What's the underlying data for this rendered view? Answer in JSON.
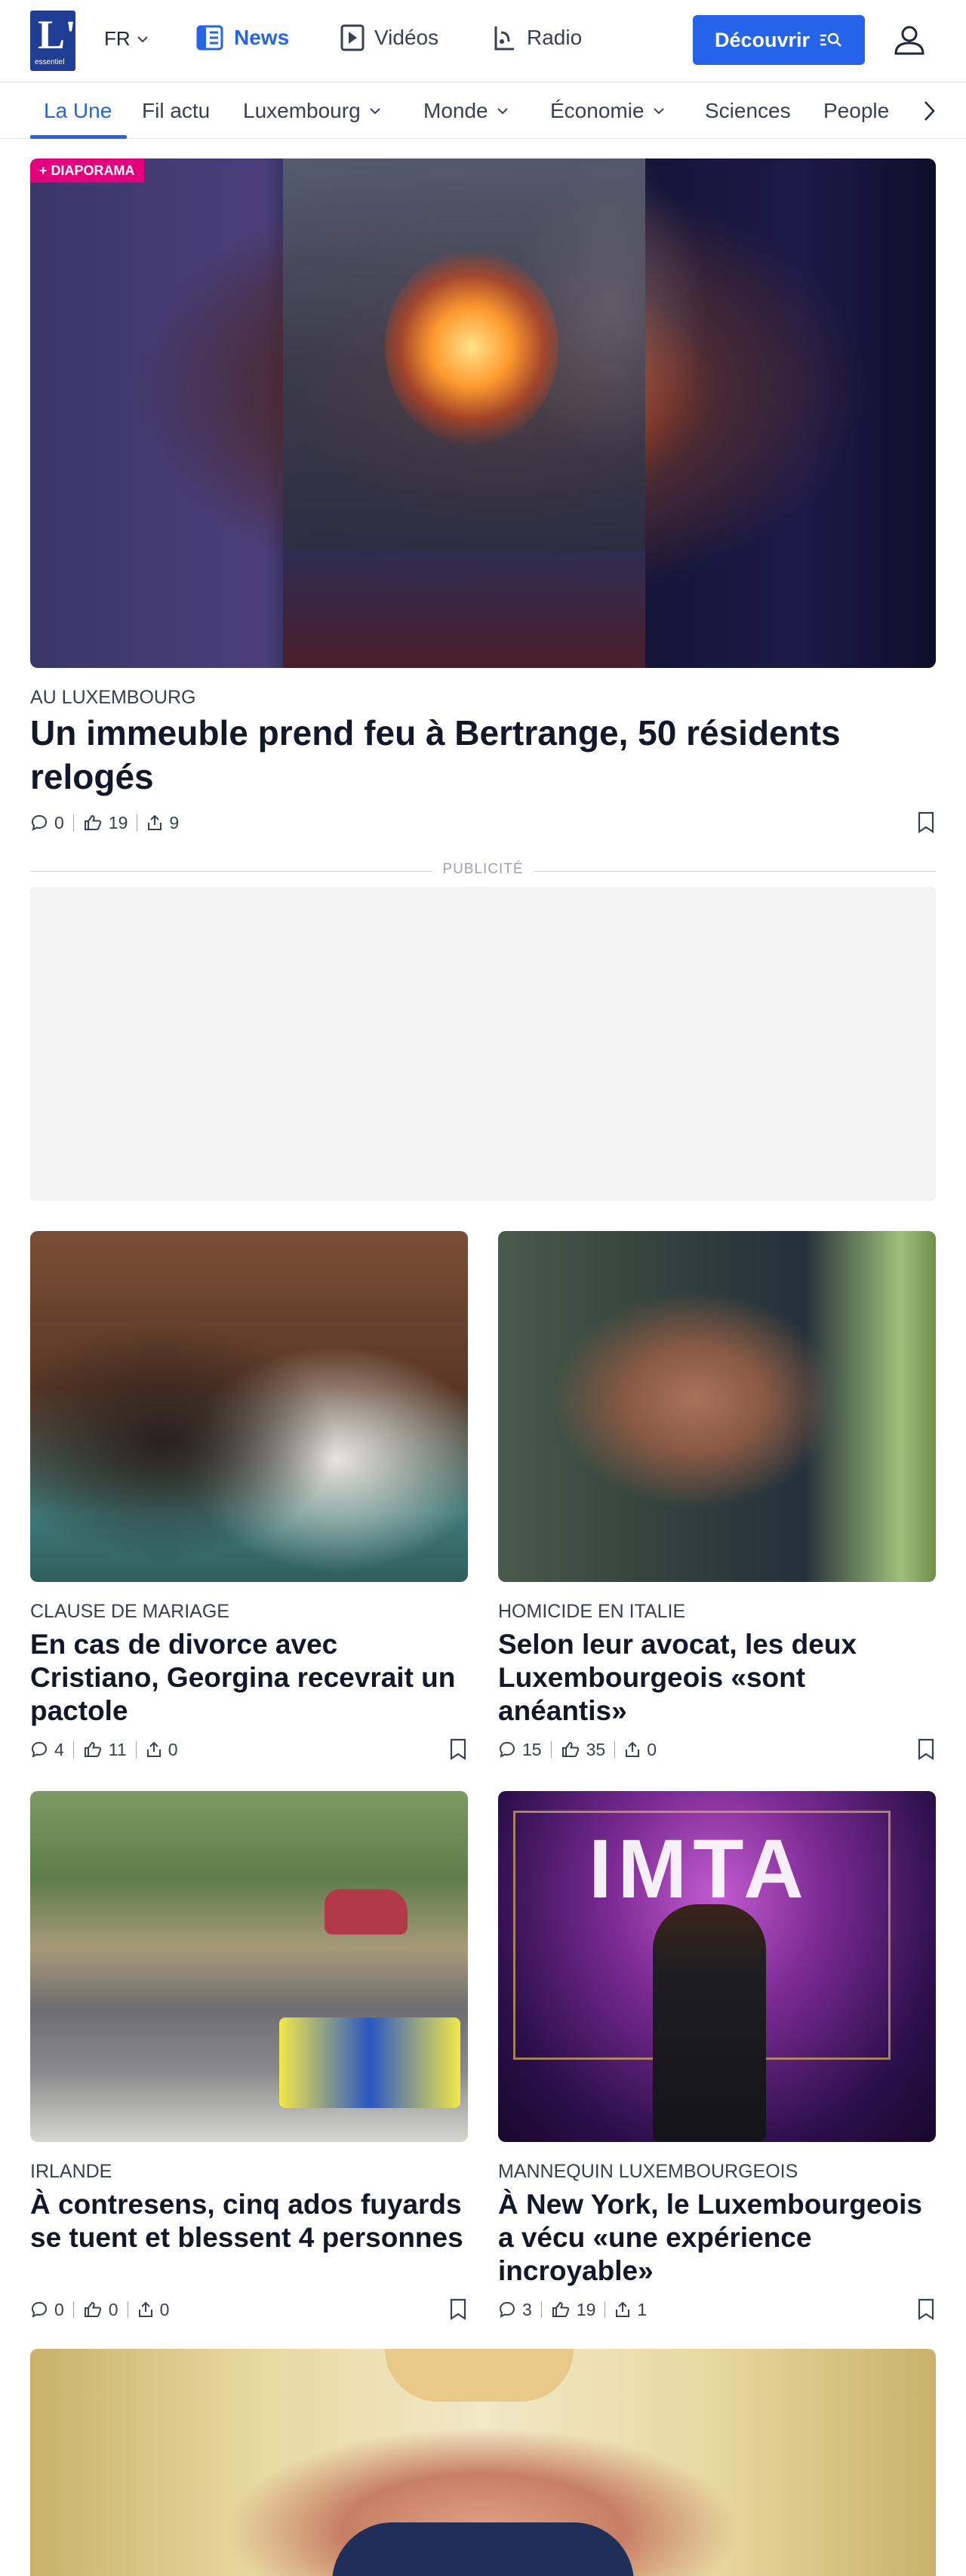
{
  "header": {
    "logo_letter": "L'",
    "logo_text": "essentiel",
    "language": "FR",
    "nav": [
      {
        "label": "News",
        "icon": "news-icon",
        "active": true
      },
      {
        "label": "Vidéos",
        "icon": "play-icon",
        "active": false
      },
      {
        "label": "Radio",
        "icon": "radio-icon",
        "active": false
      }
    ],
    "cta_label": "Découvrir",
    "accent_color": "#2563eb"
  },
  "categories": [
    {
      "label": "La Une",
      "active": true,
      "dropdown": false
    },
    {
      "label": "Fil actu",
      "active": false,
      "dropdown": false
    },
    {
      "label": "Luxembourg",
      "active": false,
      "dropdown": true
    },
    {
      "label": "Monde",
      "active": false,
      "dropdown": true
    },
    {
      "label": "Économie",
      "active": false,
      "dropdown": true
    },
    {
      "label": "Sciences",
      "active": false,
      "dropdown": false
    },
    {
      "label": "People",
      "active": false,
      "dropdown": false
    }
  ],
  "hero": {
    "badge": "+ DIAPORAMA",
    "kicker": "AU LUXEMBOURG",
    "title": "Un immeuble prend feu à Bertrange, 50 résidents relogés",
    "comments": "0",
    "likes": "19",
    "shares": "9"
  },
  "ad_label": "PUBLICITÉ",
  "articles": [
    {
      "kicker": "CLAUSE DE MARIAGE",
      "title": "En cas de divorce avec Cristiano, Georgina recevrait un pactole",
      "comments": "4",
      "likes": "11",
      "shares": "0"
    },
    {
      "kicker": "HOMICIDE EN ITALIE",
      "title": "Selon leur avocat, les deux Luxembourgeois «sont anéantis»",
      "comments": "15",
      "likes": "35",
      "shares": "0"
    },
    {
      "kicker": "IRLANDE",
      "title": "À contresens, cinq ados fuyards se tuent et blessent 4 personnes",
      "comments": "0",
      "likes": "0",
      "shares": "0"
    },
    {
      "kicker": "MANNEQUIN LUXEMBOURGEOIS",
      "title": "À New York, le Luxembourgeois a vécu «une expérience incroyable»",
      "comments": "3",
      "likes": "19",
      "shares": "1"
    }
  ],
  "image_texts": {
    "imta_sign": "IMTA"
  }
}
